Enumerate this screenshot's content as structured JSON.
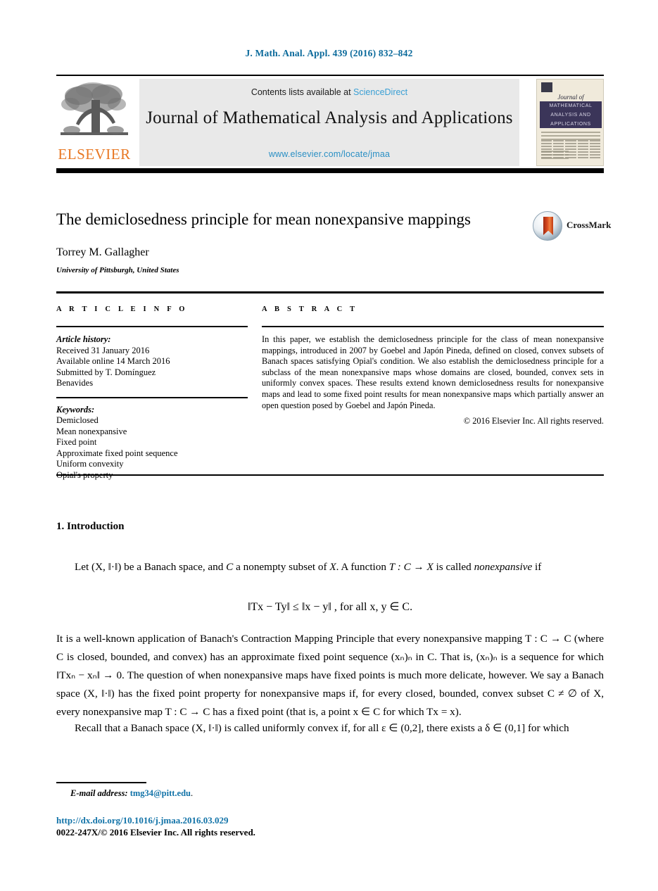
{
  "running_head": "J. Math. Anal. Appl. 439 (2016) 832–842",
  "header": {
    "publisher_name": "ELSEVIER",
    "contents_prefix": "Contents lists available at ",
    "sciencedirect_label": "ScienceDirect",
    "journal_title": "Journal of Mathematical Analysis and Applications",
    "journal_url": "www.elsevier.com/locate/jmaa",
    "sciencedirect_color": "#3a9fd4",
    "url_color": "#2a8fc4",
    "elsevier_orange": "#E87722",
    "cover": {
      "journal_word": "Journal of",
      "band_line1": "MATHEMATICAL",
      "band_line2": "ANALYSIS AND",
      "band_line3": "APPLICATIONS"
    }
  },
  "article": {
    "title": "The demiclosedness principle for mean nonexpansive mappings",
    "crossmark_label": "CrossMark",
    "author": "Torrey M. Gallagher",
    "affiliation": "University of Pittsburgh, United States"
  },
  "info": {
    "heading": "A R T I C L E   I N F O",
    "history_label": "Article history:",
    "history_lines": [
      "Received 31 January 2016",
      "Available online 14 March 2016",
      "Submitted by T. Domínguez",
      "Benavides"
    ],
    "keywords_label": "Keywords:",
    "keywords": [
      "Demiclosed",
      "Mean nonexpansive",
      "Fixed point",
      "Approximate fixed point sequence",
      "Uniform convexity",
      "Opial's property"
    ]
  },
  "abstract": {
    "heading": "A B S T R A C T",
    "text": "In this paper, we establish the demiclosedness principle for the class of mean nonexpansive mappings, introduced in 2007 by Goebel and Japón Pineda, defined on closed, convex subsets of Banach spaces satisfying Opial's condition. We also establish the demiclosedness principle for a subclass of the mean nonexpansive maps whose domains are closed, bounded, convex sets in uniformly convex spaces. These results extend known demiclosedness results for nonexpansive maps and lead to some fixed point results for mean nonexpansive maps which partially answer an open question posed by Goebel and Japón Pineda.",
    "copyright": "© 2016 Elsevier Inc. All rights reserved."
  },
  "body": {
    "section_heading": "1. Introduction",
    "paragraph1_a": "Let (X, ‖·‖) be a Banach space, and ",
    "paragraph1_b": "C",
    "paragraph1_c": " a nonempty subset of ",
    "paragraph1_d": "X",
    "paragraph1_e": ". A function ",
    "paragraph1_f": "T : C → X",
    "paragraph1_g": " is called ",
    "paragraph1_h": "nonexpansive",
    "paragraph1_i": " if",
    "equation": "‖Tx − Ty‖ ≤ ‖x − y‖ , for all x, y ∈ C.",
    "paragraph2": "It is a well-known application of Banach's Contraction Mapping Principle that every nonexpansive mapping T : C → C (where C is closed, bounded, and convex) has an approximate fixed point sequence (xₙ)ₙ in C. That is, (xₙ)ₙ is a sequence for which ‖Txₙ − xₙ‖ → 0. The question of when nonexpansive maps have fixed points is much more delicate, however. We say a Banach space (X, ‖·‖) has the fixed point property for nonexpansive maps if, for every closed, bounded, convex subset C ≠ ∅ of X, every nonexpansive map T : C → C has a fixed point (that is, a point x ∈ C for which Tx = x).",
    "paragraph3": "Recall that a Banach space (X, ‖·‖) is called uniformly convex if, for all ε ∈ (0,2], there exists a δ ∈ (0,1] for which"
  },
  "footer": {
    "email_label": "E-mail address:",
    "email": "tmg34@pitt.edu",
    "email_suffix": ".",
    "doi": "http://dx.doi.org/10.1016/j.jmaa.2016.03.029",
    "issn_line": "0022-247X/© 2016 Elsevier Inc. All rights reserved.",
    "link_color": "#1273a8"
  }
}
